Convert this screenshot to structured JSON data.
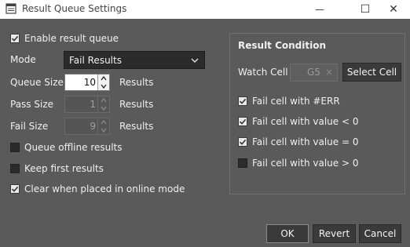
{
  "window": {
    "title": "Result Queue Settings",
    "min_glyph": "—",
    "max_glyph": "☐",
    "close_glyph": "✕"
  },
  "queue": {
    "enable_label": "Enable result queue",
    "enable_checked": true,
    "mode_label": "Mode",
    "mode_value": "Fail Results",
    "queue_size_label": "Queue Size",
    "queue_size_value": "10",
    "pass_size_label": "Pass Size",
    "pass_size_value": "1",
    "fail_size_label": "Fail Size",
    "fail_size_value": "9",
    "results_unit": "Results",
    "offline_label": "Queue offline results",
    "offline_checked": false,
    "keep_first_label": "Keep first results",
    "keep_first_checked": false,
    "clear_online_label": "Clear when placed in online mode",
    "clear_online_checked": true
  },
  "condition": {
    "title": "Result Condition",
    "watch_cell_label": "Watch Cell",
    "watch_cell_value": "G5",
    "clear_glyph": "×",
    "select_cell_button": "Select Cell",
    "options": [
      {
        "label": "Fail cell with #ERR",
        "checked": true
      },
      {
        "label": "Fail cell with value < 0",
        "checked": true
      },
      {
        "label": "Fail cell with value = 0",
        "checked": true
      },
      {
        "label": "Fail cell with value > 0",
        "checked": false
      }
    ]
  },
  "footer": {
    "ok": "OK",
    "revert": "Revert",
    "cancel": "Cancel"
  },
  "icons": {
    "app": "settings-window-icon",
    "check": "checkmark-icon",
    "dropdown": "chevron-down-icon",
    "spin_up": "arrow-up-icon",
    "spin_down": "arrow-down-icon"
  }
}
